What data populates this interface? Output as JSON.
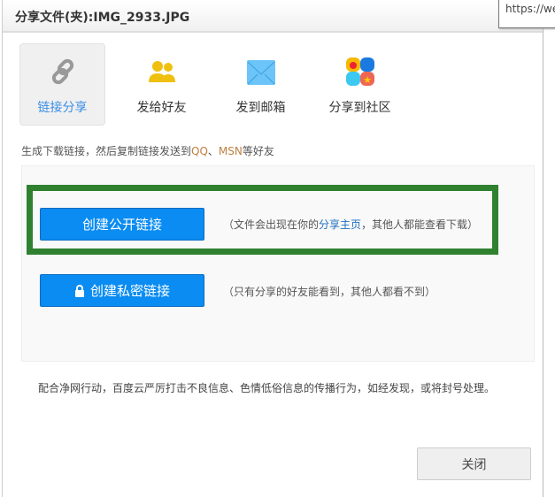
{
  "title": "分享文件(夹):IMG_2933.JPG",
  "tooltip": "https://we",
  "tabs": [
    {
      "label": "链接分享"
    },
    {
      "label": "发给好友"
    },
    {
      "label": "发到邮箱"
    },
    {
      "label": "分享到社区"
    }
  ],
  "desc": {
    "pre": "生成下载链接，然后复制链接发送到",
    "qq": "QQ",
    "sep": "、",
    "msn": "MSN",
    "post": "等好友"
  },
  "public": {
    "button": "创建公开链接",
    "note_pre": "（文件会出现在你的",
    "note_link": "分享主页",
    "note_post": "，其他人都能查看下载）"
  },
  "private": {
    "button": "创建私密链接",
    "note": "（只有分享的好友能看到，其他人都看不到）"
  },
  "footer_note": "配合净网行动，百度云严厉打击不良信息、色情低俗信息的传播行为，如经发现，或将封号处理。",
  "close": "关闭"
}
